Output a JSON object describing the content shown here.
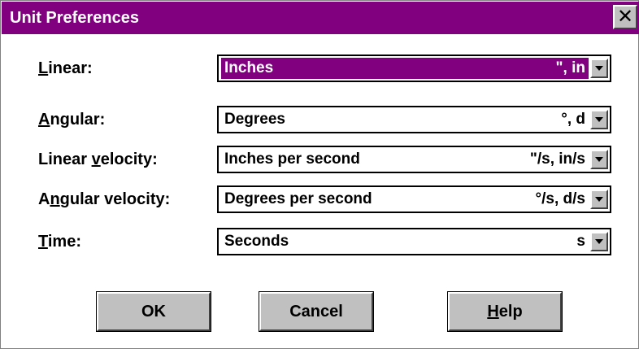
{
  "window": {
    "title": "Unit Preferences",
    "close_glyph": "✕"
  },
  "fields": [
    {
      "label_mnemonic": "L",
      "label_rest": "inear:",
      "label_pre": "",
      "value": "Inches",
      "abbr": "\", in",
      "selected": true
    },
    {
      "label_mnemonic": "A",
      "label_rest": "ngular:",
      "label_pre": "",
      "value": "Degrees",
      "abbr": "°, d",
      "selected": false
    },
    {
      "label_pre": "Linear ",
      "label_mnemonic": "v",
      "label_rest": "elocity:",
      "value": "Inches per second",
      "abbr": "\"/s, in/s",
      "selected": false
    },
    {
      "label_pre": "A",
      "label_mnemonic": "n",
      "label_rest": "gular velocity:",
      "value": "Degrees per second",
      "abbr": "°/s, d/s",
      "selected": false
    },
    {
      "label_pre": "",
      "label_mnemonic": "T",
      "label_rest": "ime:",
      "value": "Seconds",
      "abbr": "s",
      "selected": false
    }
  ],
  "buttons": {
    "ok_label": "OK",
    "cancel_label": "Cancel",
    "help_mnemonic": "H",
    "help_rest": "elp"
  },
  "colors": {
    "title_bar": "#800080",
    "selection": "#800080",
    "button_face": "#c0c0c0"
  },
  "icons": {
    "close": "close-icon",
    "dropdown": "chevron-down-icon"
  }
}
